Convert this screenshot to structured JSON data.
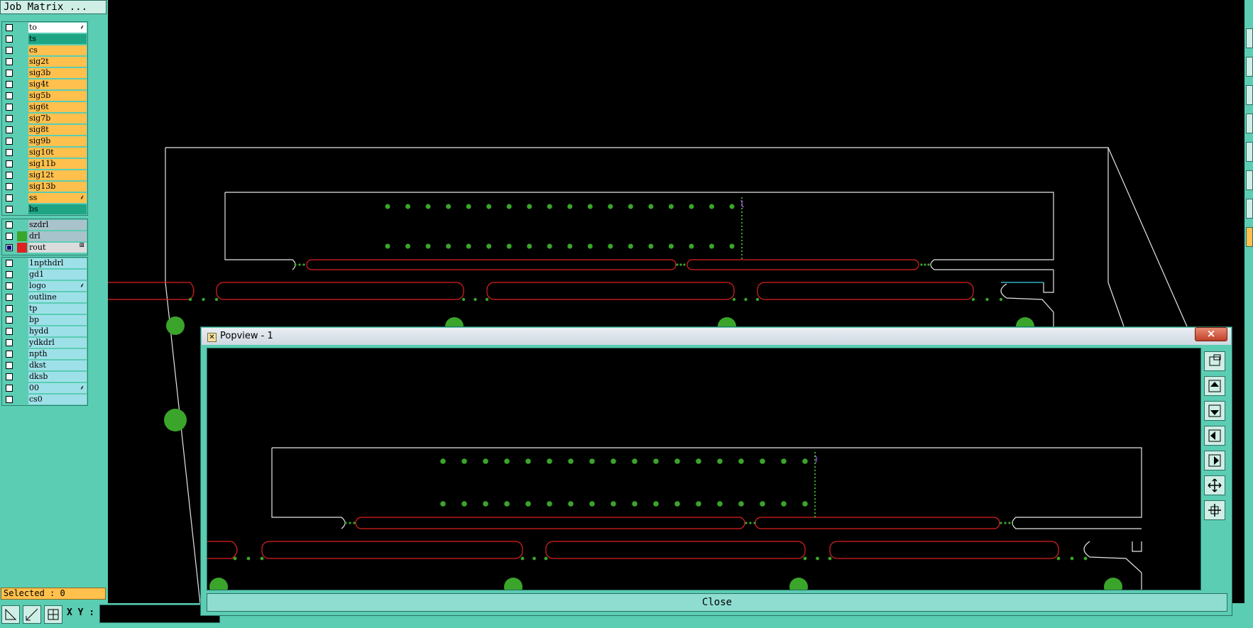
{
  "job_matrix": {
    "label": "Job Matrix ..."
  },
  "layer_groups": [
    {
      "rows": [
        {
          "name": "to",
          "bg": "#ffffff",
          "flag": "⸙",
          "checked": false,
          "swatch": ""
        },
        {
          "name": "ts",
          "bg": "#1ea584",
          "flag": "",
          "checked": false,
          "swatch": ""
        },
        {
          "name": "cs",
          "bg": "#ffc04d",
          "flag": "",
          "checked": false,
          "swatch": ""
        },
        {
          "name": "sig2t",
          "bg": "#ffc04d",
          "flag": "",
          "checked": false,
          "swatch": ""
        },
        {
          "name": "sig3b",
          "bg": "#ffc04d",
          "flag": "",
          "checked": false,
          "swatch": ""
        },
        {
          "name": "sig4t",
          "bg": "#ffc04d",
          "flag": "",
          "checked": false,
          "swatch": ""
        },
        {
          "name": "sig5b",
          "bg": "#ffc04d",
          "flag": "",
          "checked": false,
          "swatch": ""
        },
        {
          "name": "sig6t",
          "bg": "#ffc04d",
          "flag": "",
          "checked": false,
          "swatch": ""
        },
        {
          "name": "sig7b",
          "bg": "#ffc04d",
          "flag": "",
          "checked": false,
          "swatch": ""
        },
        {
          "name": "sig8t",
          "bg": "#ffc04d",
          "flag": "",
          "checked": false,
          "swatch": ""
        },
        {
          "name": "sig9b",
          "bg": "#ffc04d",
          "flag": "",
          "checked": false,
          "swatch": ""
        },
        {
          "name": "sig10t",
          "bg": "#ffc04d",
          "flag": "",
          "checked": false,
          "swatch": ""
        },
        {
          "name": "sig11b",
          "bg": "#ffc04d",
          "flag": "",
          "checked": false,
          "swatch": ""
        },
        {
          "name": "sig12t",
          "bg": "#ffc04d",
          "flag": "",
          "checked": false,
          "swatch": ""
        },
        {
          "name": "sig13b",
          "bg": "#ffc04d",
          "flag": "",
          "checked": false,
          "swatch": ""
        },
        {
          "name": "ss",
          "bg": "#ffc04d",
          "flag": "⸙",
          "checked": false,
          "swatch": ""
        },
        {
          "name": "bs",
          "bg": "#1ea584",
          "flag": "",
          "checked": false,
          "swatch": ""
        }
      ]
    },
    {
      "rows": [
        {
          "name": "szdrl",
          "bg": "#a9c3cc",
          "flag": "",
          "checked": false,
          "swatch": ""
        },
        {
          "name": "drl",
          "bg": "#a9c3cc",
          "flag": "",
          "checked": false,
          "swatch": "#3aa52a"
        },
        {
          "name": "rout",
          "bg": "#dcdcdc",
          "flag": "⊞",
          "checked": true,
          "swatch": "#e02020"
        }
      ]
    },
    {
      "rows": [
        {
          "name": "1npthdrl",
          "bg": "#9ee0e8",
          "flag": "",
          "checked": false,
          "swatch": ""
        },
        {
          "name": "gd1",
          "bg": "#9ee0e8",
          "flag": "",
          "checked": false,
          "swatch": ""
        },
        {
          "name": "logo",
          "bg": "#9ee0e8",
          "flag": "⸙",
          "checked": false,
          "swatch": ""
        },
        {
          "name": "outline",
          "bg": "#9ee0e8",
          "flag": "",
          "checked": false,
          "swatch": ""
        },
        {
          "name": "tp",
          "bg": "#9ee0e8",
          "flag": "",
          "checked": false,
          "swatch": ""
        },
        {
          "name": "bp",
          "bg": "#9ee0e8",
          "flag": "",
          "checked": false,
          "swatch": ""
        },
        {
          "name": "hydd",
          "bg": "#9ee0e8",
          "flag": "",
          "checked": false,
          "swatch": ""
        },
        {
          "name": "ydkdrl",
          "bg": "#9ee0e8",
          "flag": "",
          "checked": false,
          "swatch": ""
        },
        {
          "name": "npth",
          "bg": "#9ee0e8",
          "flag": "",
          "checked": false,
          "swatch": ""
        },
        {
          "name": "dkst",
          "bg": "#9ee0e8",
          "flag": "",
          "checked": false,
          "swatch": ""
        },
        {
          "name": "dksb",
          "bg": "#9ee0e8",
          "flag": "",
          "checked": false,
          "swatch": ""
        },
        {
          "name": "00",
          "bg": "#9ee0e8",
          "flag": "⸙",
          "checked": false,
          "swatch": ""
        },
        {
          "name": "cs0",
          "bg": "#9ee0e8",
          "flag": "",
          "checked": false,
          "swatch": ""
        }
      ]
    }
  ],
  "status": {
    "selected": "Selected : 0"
  },
  "bottom_bar": {
    "xy_label": "X Y :",
    "xy_value": ""
  },
  "popview": {
    "title": "Popview - 1",
    "close_label": "Close",
    "close_x": "×"
  },
  "colors": {
    "panel": "#5bcdb3",
    "outline": "#e6e6e6",
    "rout": "#e02020",
    "pad": "#3aa52a",
    "cursor": "#b070ff"
  }
}
